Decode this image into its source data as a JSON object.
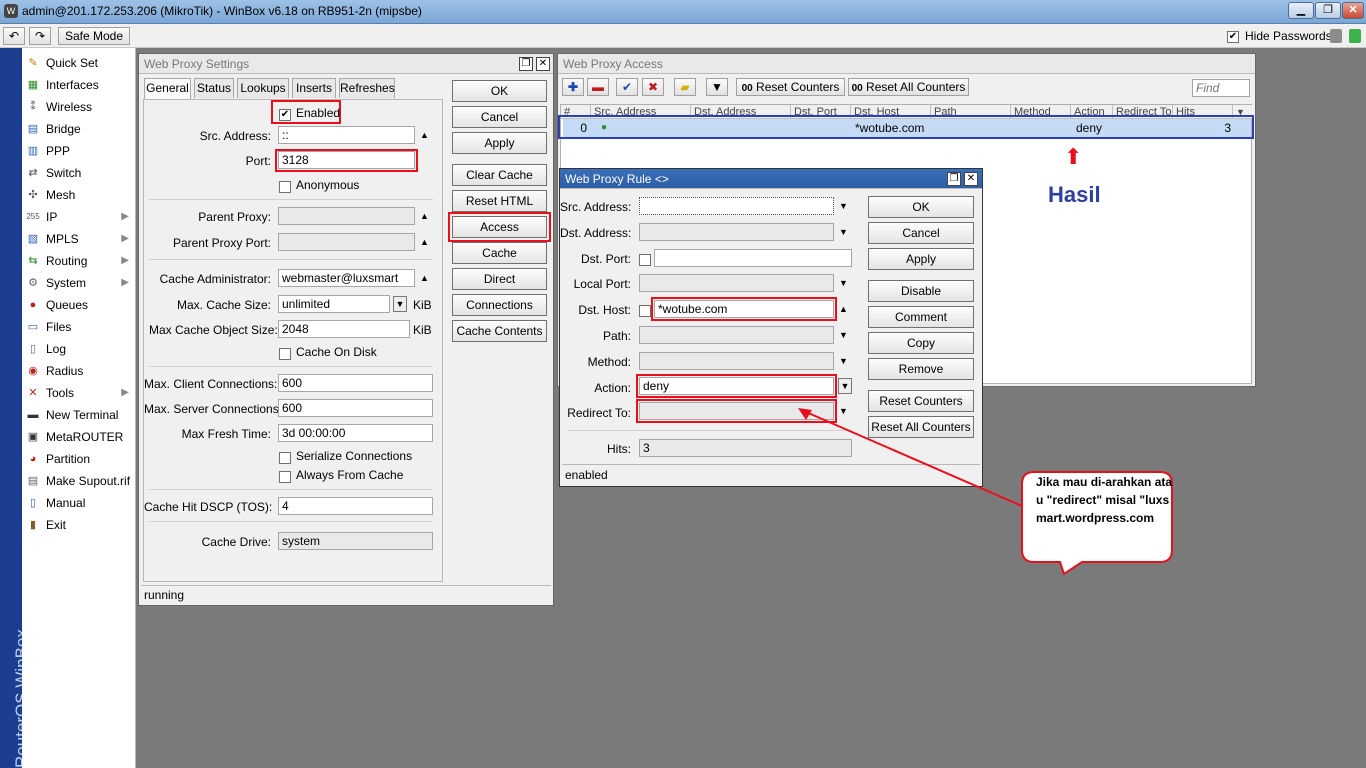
{
  "titlebar": {
    "title": "admin@201.172.253.206 (MikroTik) - WinBox v6.18 on RB951-2n (mipsbe)"
  },
  "toolbar": {
    "safe_mode": "Safe Mode",
    "hide_passwords": "Hide Passwords"
  },
  "sidebar": {
    "brand": "RouterOS WinBox",
    "items": [
      {
        "label": "Quick Set",
        "icon": "quickset-icon"
      },
      {
        "label": "Interfaces",
        "icon": "interfaces-icon"
      },
      {
        "label": "Wireless",
        "icon": "wireless-icon"
      },
      {
        "label": "Bridge",
        "icon": "bridge-icon"
      },
      {
        "label": "PPP",
        "icon": "ppp-icon"
      },
      {
        "label": "Switch",
        "icon": "switch-icon"
      },
      {
        "label": "Mesh",
        "icon": "mesh-icon"
      },
      {
        "label": "IP",
        "icon": "ip-icon"
      },
      {
        "label": "MPLS",
        "icon": "mpls-icon"
      },
      {
        "label": "Routing",
        "icon": "routing-icon"
      },
      {
        "label": "System",
        "icon": "system-icon"
      },
      {
        "label": "Queues",
        "icon": "queues-icon"
      },
      {
        "label": "Files",
        "icon": "files-icon"
      },
      {
        "label": "Log",
        "icon": "log-icon"
      },
      {
        "label": "Radius",
        "icon": "radius-icon"
      },
      {
        "label": "Tools",
        "icon": "tools-icon"
      },
      {
        "label": "New Terminal",
        "icon": "terminal-icon"
      },
      {
        "label": "MetaROUTER",
        "icon": "metarouter-icon"
      },
      {
        "label": "Partition",
        "icon": "partition-icon"
      },
      {
        "label": "Make Supout.rif",
        "icon": "supout-icon"
      },
      {
        "label": "Manual",
        "icon": "manual-icon"
      },
      {
        "label": "Exit",
        "icon": "exit-icon"
      }
    ]
  },
  "proxy_settings": {
    "title": "Web Proxy Settings",
    "tabs": [
      "General",
      "Status",
      "Lookups",
      "Inserts",
      "Refreshes"
    ],
    "enabled_label": "Enabled",
    "src_address_label": "Src. Address:",
    "src_address": "::",
    "port_label": "Port:",
    "port": "3128",
    "anonymous_label": "Anonymous",
    "parent_proxy_label": "Parent Proxy:",
    "parent_proxy_port_label": "Parent Proxy Port:",
    "cache_admin_label": "Cache Administrator:",
    "cache_admin": "webmaster@luxsmart",
    "max_cache_size_label": "Max. Cache Size:",
    "max_cache_size": "unlimited",
    "max_cache_obj_label": "Max Cache Object Size:",
    "max_cache_obj": "2048",
    "unit_kib": "KiB",
    "cache_on_disk_label": "Cache On Disk",
    "max_client_label": "Max. Client Connections:",
    "max_client": "600",
    "max_server_label": "Max. Server Connections:",
    "max_server": "600",
    "max_fresh_label": "Max Fresh Time:",
    "max_fresh": "3d 00:00:00",
    "serialize_label": "Serialize Connections",
    "always_cache_label": "Always From Cache",
    "dscp_label": "Cache Hit DSCP (TOS):",
    "dscp": "4",
    "cache_drive_label": "Cache Drive:",
    "cache_drive": "system",
    "status": "running",
    "buttons": [
      "OK",
      "Cancel",
      "Apply",
      "Clear Cache",
      "Reset HTML",
      "Access",
      "Cache",
      "Direct",
      "Connections",
      "Cache Contents"
    ]
  },
  "proxy_access": {
    "title": "Web Proxy Access",
    "reset_counters": "Reset Counters",
    "reset_all_counters": "Reset All Counters",
    "find_placeholder": "Find",
    "columns": [
      "#",
      "Src. Address",
      "Dst. Address",
      "Dst. Port",
      "Dst. Host",
      "Path",
      "Method",
      "Action",
      "Redirect To",
      "Hits"
    ],
    "rows": [
      {
        "num": "0",
        "src": "",
        "dst": "",
        "dport": "",
        "dhost": "*wotube.com",
        "path": "",
        "method": "",
        "action": "deny",
        "redirect": "",
        "hits": "3"
      }
    ]
  },
  "proxy_rule": {
    "title": "Web Proxy Rule <>",
    "src_address_label": "Src. Address:",
    "dst_address_label": "Dst. Address:",
    "dst_port_label": "Dst. Port:",
    "local_port_label": "Local Port:",
    "dst_host_label": "Dst. Host:",
    "dst_host": "*wotube.com",
    "path_label": "Path:",
    "method_label": "Method:",
    "action_label": "Action:",
    "action": "deny",
    "redirect_label": "Redirect To:",
    "hits_label": "Hits:",
    "hits": "3",
    "status": "enabled",
    "buttons": [
      "OK",
      "Cancel",
      "Apply",
      "Disable",
      "Comment",
      "Copy",
      "Remove",
      "Reset Counters",
      "Reset All Counters"
    ]
  },
  "annotation": {
    "hasil": "Hasil",
    "callout": "Jika mau di-arahkan atau \"redirect\" misal \"luxsmart.wordpress.com"
  },
  "colors": {
    "highlight": "#e8101c",
    "hasil": "#2e3fa3",
    "selection_row": "#c5dbf5"
  }
}
